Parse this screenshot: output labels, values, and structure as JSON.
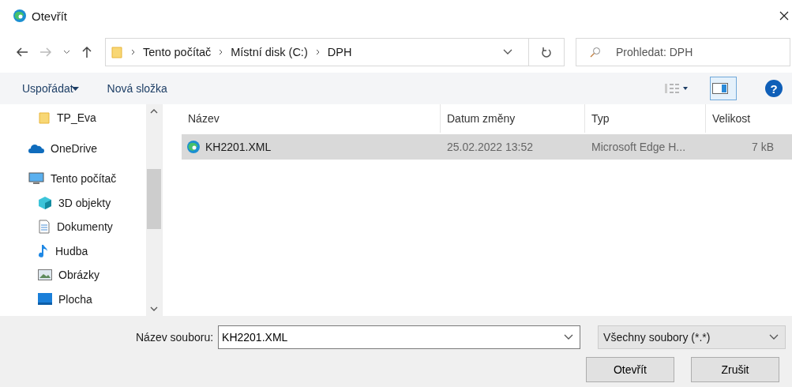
{
  "window": {
    "title": "Otevřít"
  },
  "address": {
    "path": [
      "Tento počítač",
      "Místní disk (C:)",
      "DPH"
    ]
  },
  "search": {
    "placeholder": "Prohledat: DPH"
  },
  "toolbar": {
    "organize": "Uspořádat",
    "new_folder": "Nová složka",
    "help": "?"
  },
  "sidebar": {
    "items": [
      {
        "label": "TP_Eva",
        "kind": "folder"
      },
      {
        "label": "OneDrive",
        "kind": "cloud"
      },
      {
        "label": "Tento počítač",
        "kind": "pc",
        "children": [
          {
            "label": "3D objekty",
            "kind": "cube"
          },
          {
            "label": "Dokumenty",
            "kind": "document"
          },
          {
            "label": "Hudba",
            "kind": "music"
          },
          {
            "label": "Obrázky",
            "kind": "image"
          },
          {
            "label": "Plocha",
            "kind": "desktop"
          }
        ]
      }
    ]
  },
  "table": {
    "columns": [
      "Název",
      "Datum změny",
      "Typ",
      "Velikost"
    ],
    "rows": [
      {
        "name": "KH2201.XML",
        "date": "25.02.2022 13:52",
        "type": "Microsoft Edge H...",
        "size": "7 kB",
        "selected": true
      }
    ]
  },
  "footer": {
    "file_name_label": "Název souboru:",
    "file_name": "KH2201.XML",
    "filter": "Všechny soubory (*.*)",
    "buttons": [
      "Otevřít",
      "Zrušit"
    ]
  }
}
